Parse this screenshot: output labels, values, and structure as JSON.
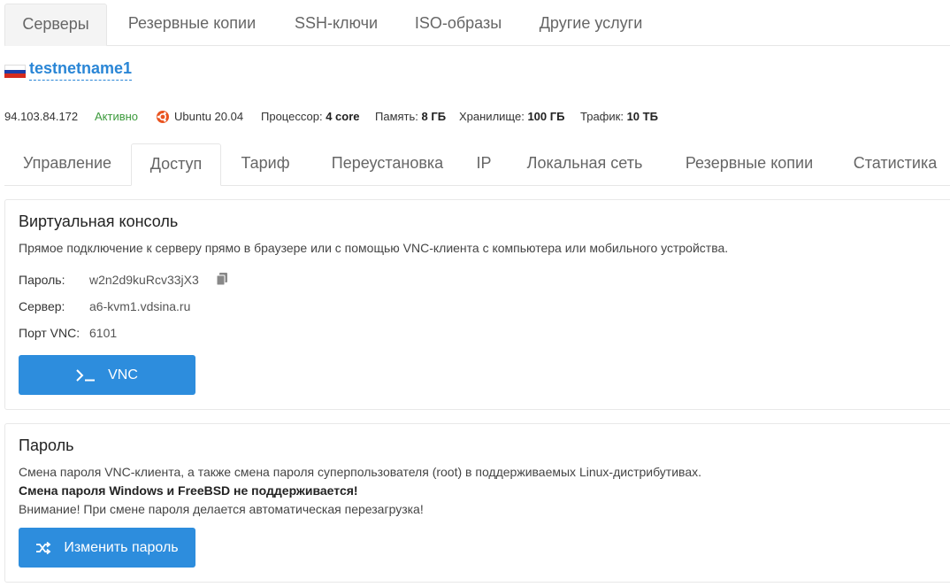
{
  "top_tabs": [
    {
      "label": "Серверы",
      "active": true
    },
    {
      "label": "Резервные копии",
      "active": false
    },
    {
      "label": "SSH-ключи",
      "active": false
    },
    {
      "label": "ISO-образы",
      "active": false
    },
    {
      "label": "Другие услуги",
      "active": false
    }
  ],
  "server": {
    "name": "testnetname1",
    "flag_icon": "russia-flag-icon",
    "ip": "94.103.84.172",
    "status": "Активно",
    "os_icon": "ubuntu-icon",
    "os": "Ubuntu 20.04",
    "cpu_label": "Процессор:",
    "cpu_value": "4 core",
    "ram_label": "Память:",
    "ram_value": "8 ГБ",
    "storage_label": "Хранилище:",
    "storage_value": "100 ГБ",
    "traffic_label": "Трафик:",
    "traffic_value": "10 ТБ"
  },
  "sub_tabs": [
    {
      "label": "Управление",
      "active": false
    },
    {
      "label": "Доступ",
      "active": true
    },
    {
      "label": "Тариф",
      "active": false
    },
    {
      "label": "Переустановка",
      "active": false
    },
    {
      "label": "IP",
      "active": false
    },
    {
      "label": "Локальная сеть",
      "active": false
    },
    {
      "label": "Резервные копии",
      "active": false
    },
    {
      "label": "Статистика",
      "active": false
    }
  ],
  "console": {
    "title": "Виртуальная консоль",
    "description": "Прямое подключение к серверу прямо в браузере или с помощью VNC-клиента с компьютера или мобильного устройства.",
    "password_label": "Пароль:",
    "password_value": "w2n2d9kuRcv33jX3",
    "server_label": "Сервер:",
    "server_value": "a6-kvm1.vdsina.ru",
    "port_label": "Порт VNC:",
    "port_value": "6101",
    "button_label": "VNC",
    "button_icon": "terminal-icon",
    "copy_icon": "copy-icon"
  },
  "password_card": {
    "title": "Пароль",
    "line1": "Смена пароля VNC-клиента, а также смена пароля суперпользователя (root) в поддерживаемых Linux-дистрибутивах.",
    "line2": "Смена пароля Windows и FreeBSD не поддерживается!",
    "line3": "Внимание! При смене пароля делается автоматическая перезагрузка!",
    "button_label": "Изменить пароль",
    "button_icon": "shuffle-icon"
  },
  "colors": {
    "accent": "#2d8ddd",
    "link": "#2a86d6",
    "status_active": "#3c9a3c"
  }
}
